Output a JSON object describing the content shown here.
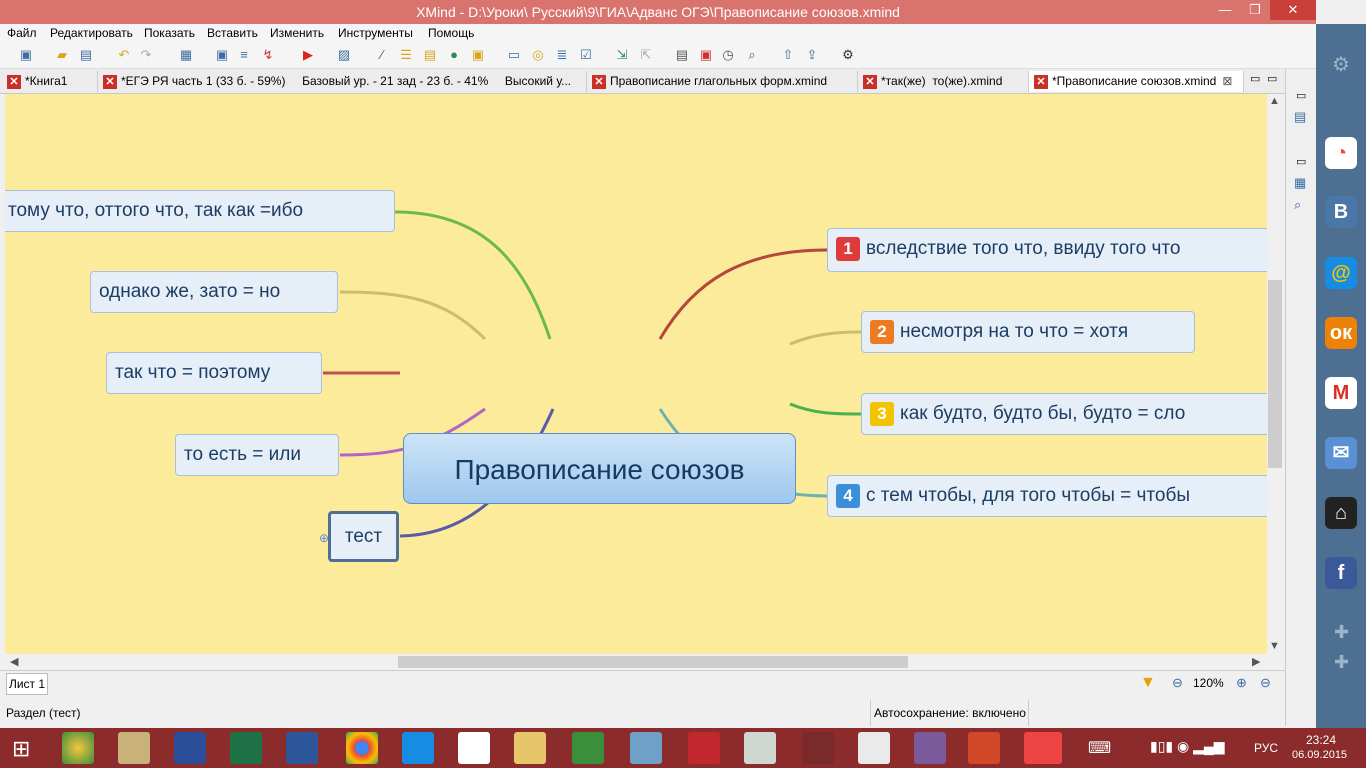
{
  "window": {
    "title": "XMind - D:\\Уроки\\ Русский\\9\\ГИА\\Адванс ОГЭ\\Правописание союзов.xmind",
    "minimize": "—",
    "restore": "❐",
    "close": "✕"
  },
  "menu": [
    "Файл",
    "Редактировать",
    "Показать",
    "Вставить",
    "Изменить",
    "Инструменты",
    "Помощь"
  ],
  "tabs": [
    {
      "label": "*Книга1"
    },
    {
      "label": "*ЕГЭ РЯ часть 1 (33 б. - 59%)     Базовый ур. - 21 зад - 23 б. - 41%     Высокий у..."
    },
    {
      "label": "Правописание глагольных форм.xmind"
    },
    {
      "label": "*так(же)  то(же).xmind"
    },
    {
      "label": "*Правописание союзов.xmind"
    }
  ],
  "map": {
    "central": "Правописание союзов",
    "left": [
      "тому что, оттого что, так как =ибо",
      "однако же, зато = но",
      "так что = поэтому",
      "то есть = или",
      "тест"
    ],
    "right": [
      {
        "num": "1",
        "text": "вследствие того что, ввиду того что",
        "color": "#e03b3b"
      },
      {
        "num": "2",
        "text": "несмотря на то что = хотя",
        "color": "#ee7a22"
      },
      {
        "num": "3",
        "text": "как будто, будто бы, будто = сло",
        "color": "#f2c400"
      },
      {
        "num": "4",
        "text": "с тем чтобы, для того чтобы = чтобы",
        "color": "#3b8fd8"
      }
    ]
  },
  "sheet": {
    "label": "Лист 1",
    "zoom": "120%"
  },
  "status": {
    "left": "Раздел (тест)",
    "autosave": "Автосохранение: включено"
  },
  "clock": {
    "time": "23:24",
    "date": "06.09.2015",
    "lang": "РУС"
  },
  "colors": {
    "titlebar": "#d9736e",
    "canvas": "#fdeb9c",
    "taskbar": "#8c2b2b",
    "social": "#4d6f91"
  }
}
